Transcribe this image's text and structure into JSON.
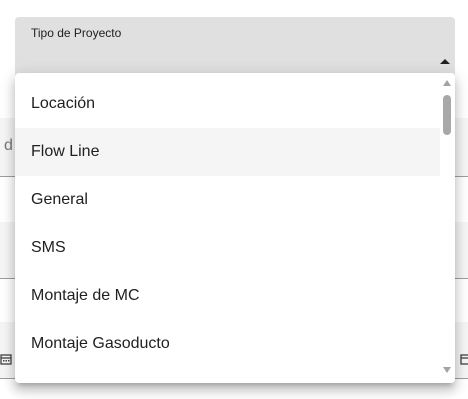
{
  "select": {
    "label": "Tipo de Proyecto",
    "arrow_icon": "arrow-up-icon"
  },
  "background": {
    "partial_text": "d",
    "calendar_icon": "calendar-icon"
  },
  "dropdown": {
    "options": [
      {
        "label": "Locación"
      },
      {
        "label": "Flow Line",
        "highlighted": true
      },
      {
        "label": "General"
      },
      {
        "label": "SMS"
      },
      {
        "label": "Montaje de MC"
      },
      {
        "label": "Montaje Gasoducto"
      }
    ]
  },
  "colors": {
    "field_bg": "#e0e0e0",
    "highlight_bg": "#f5f5f5",
    "text": "#212121",
    "scrollbar_thumb": "#a8a8a8"
  }
}
